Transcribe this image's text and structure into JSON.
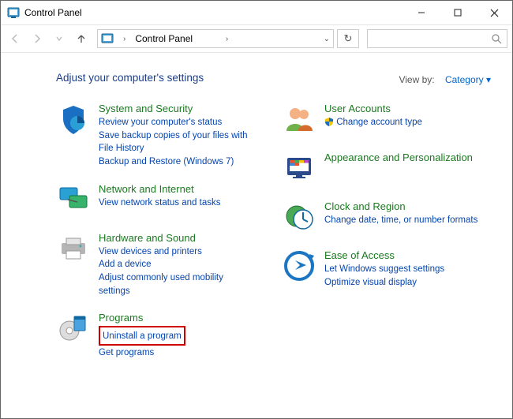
{
  "window": {
    "title": "Control Panel"
  },
  "address": {
    "path": "Control Panel"
  },
  "heading": "Adjust your computer's settings",
  "viewby": {
    "label": "View by:",
    "value": "Category"
  },
  "left": [
    {
      "title": "System and Security",
      "links": [
        "Review your computer's status",
        "Save backup copies of your files with File History",
        "Backup and Restore (Windows 7)"
      ]
    },
    {
      "title": "Network and Internet",
      "links": [
        "View network status and tasks"
      ]
    },
    {
      "title": "Hardware and Sound",
      "links": [
        "View devices and printers",
        "Add a device",
        "Adjust commonly used mobility settings"
      ]
    },
    {
      "title": "Programs",
      "links": [
        "Uninstall a program",
        "Get programs"
      ],
      "highlight_index": 0
    }
  ],
  "right": [
    {
      "title": "User Accounts",
      "links": [
        "Change account type"
      ],
      "shield": [
        0
      ]
    },
    {
      "title": "Appearance and Personalization",
      "links": []
    },
    {
      "title": "Clock and Region",
      "links": [
        "Change date, time, or number formats"
      ]
    },
    {
      "title": "Ease of Access",
      "links": [
        "Let Windows suggest settings",
        "Optimize visual display"
      ]
    }
  ]
}
